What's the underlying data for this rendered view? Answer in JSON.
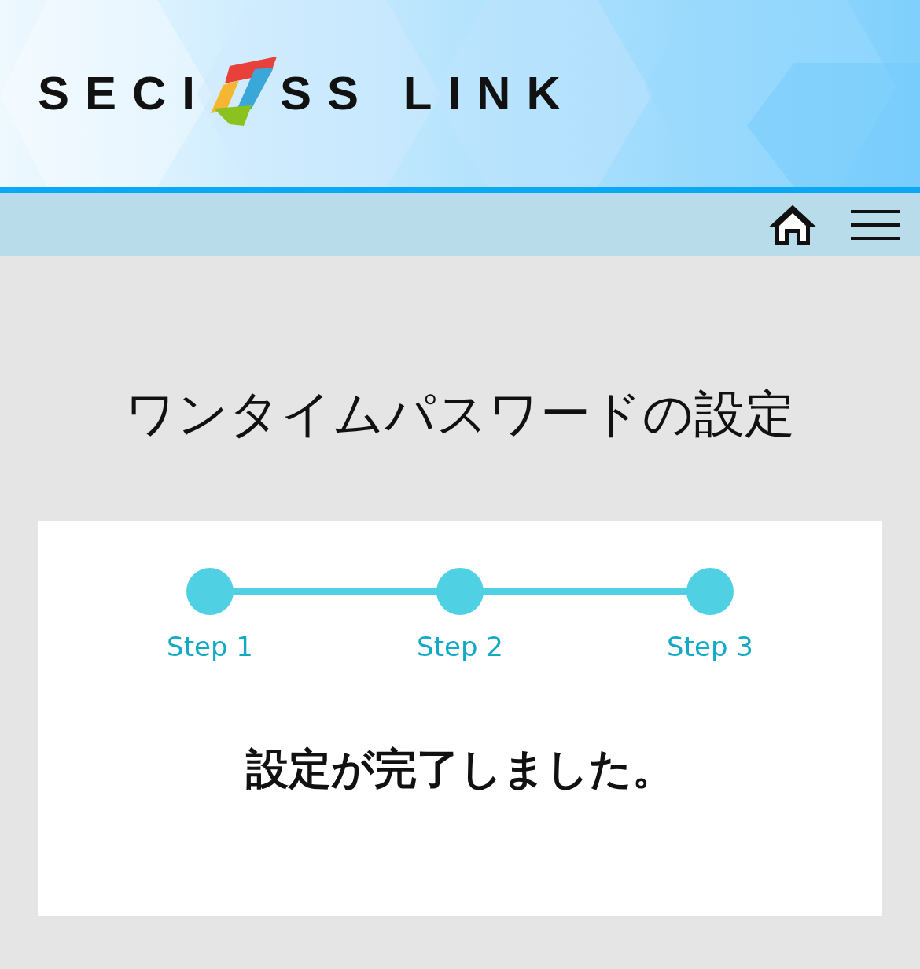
{
  "header": {
    "logo_text_start": "SECI",
    "logo_text_end": "SS LINK"
  },
  "title": "ワンタイムパスワードの設定",
  "steps": [
    {
      "label": "Step 1",
      "done": true
    },
    {
      "label": "Step 2",
      "done": true
    },
    {
      "label": "Step 3",
      "done": true
    }
  ],
  "message": "設定が完了しました。"
}
